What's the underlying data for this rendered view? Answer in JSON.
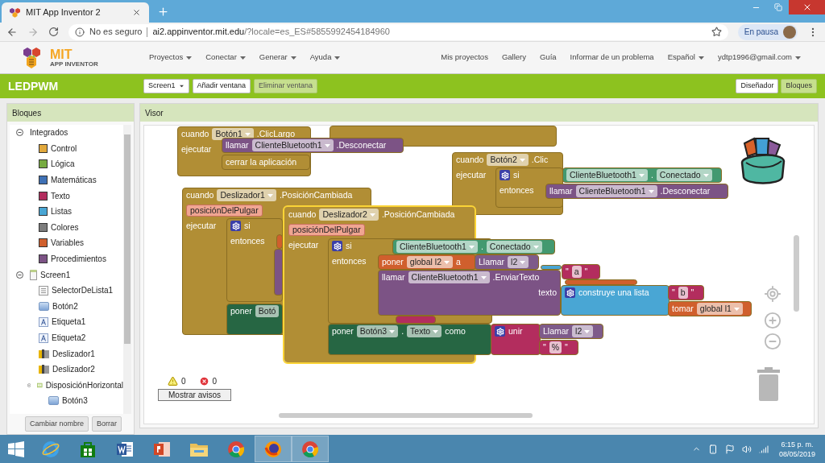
{
  "browser": {
    "tab_title": "MIT App Inventor 2",
    "security": "No es seguro",
    "url_host": "ai2.appinventor.mit.edu",
    "url_rest": "/?locale=es_ES#5855992454184960",
    "profile_status": "En pausa"
  },
  "app": {
    "logo": {
      "mark": "MIT",
      "name": "APP INVENTOR"
    },
    "menus": [
      {
        "label": "Proyectos",
        "dropdown": true
      },
      {
        "label": "Conectar",
        "dropdown": true
      },
      {
        "label": "Generar",
        "dropdown": true
      },
      {
        "label": "Ayuda",
        "dropdown": true
      }
    ],
    "right_links": [
      {
        "label": "Mis proyectos",
        "dropdown": false
      },
      {
        "label": "Gallery",
        "dropdown": false
      },
      {
        "label": "Guía",
        "dropdown": false
      },
      {
        "label": "Informar de un problema",
        "dropdown": false
      },
      {
        "label": "Español",
        "dropdown": true
      },
      {
        "label": "ydtp1996@gmail.com",
        "dropdown": true
      }
    ]
  },
  "project_bar": {
    "name": "LEDPWM",
    "screen": "Screen1",
    "buttons": [
      {
        "label": "Añadir ventana",
        "disabled": false
      },
      {
        "label": "Eliminar ventana",
        "disabled": true
      }
    ],
    "modes": [
      {
        "label": "Diseñador",
        "selected": false
      },
      {
        "label": "Bloques",
        "selected": true
      }
    ]
  },
  "blocks_panel": {
    "title": "Bloques",
    "tree": [
      {
        "label": "Integrados",
        "expanded": true,
        "children": [
          {
            "label": "Control",
            "color": "#e1a83c"
          },
          {
            "label": "Lógica",
            "color": "#77ab41"
          },
          {
            "label": "Matemáticas",
            "color": "#3f71b5"
          },
          {
            "label": "Texto",
            "color": "#b32d5e"
          },
          {
            "label": "Listas",
            "color": "#49a6d4"
          },
          {
            "label": "Colores",
            "color": "#7d7d7d"
          },
          {
            "label": "Variables",
            "color": "#d05f2d"
          },
          {
            "label": "Procedimientos",
            "color": "#7c5385"
          }
        ]
      },
      {
        "label": "Screen1",
        "kind": "screen",
        "expanded": true,
        "children": [
          {
            "label": "SelectorDeLista1",
            "kind": "listpicker"
          },
          {
            "label": "Botón2",
            "kind": "button"
          },
          {
            "label": "Etiqueta1",
            "kind": "label"
          },
          {
            "label": "Etiqueta2",
            "kind": "label"
          },
          {
            "label": "Deslizador1",
            "kind": "slider"
          },
          {
            "label": "Deslizador2",
            "kind": "slider"
          },
          {
            "label": "DisposiciónHorizontal",
            "kind": "arrangement",
            "expanded": true,
            "children": [
              {
                "label": "Botón3",
                "kind": "button"
              }
            ]
          }
        ]
      }
    ],
    "buttons": [
      "Cambiar nombre",
      "Borrar"
    ]
  },
  "viewer": {
    "title": "Visor",
    "blocks": [
      {
        "kind": "control",
        "selected": false
      },
      {
        "kind": "control",
        "selected": false,
        "rows": [
          [
            {
              "kind": "text",
              "text": "cuando"
            },
            {
              "kind": "field",
              "text": "Botón1"
            },
            {
              "kind": "text",
              "text": ".ClicLargo"
            }
          ],
          [
            {
              "kind": "text",
              "text": "ejecutar"
            }
          ]
        ],
        "children": [
          {
            "kind": "method",
            "selected": false,
            "rows": [
              [
                {
                  "kind": "text",
                  "text": "llamar"
                },
                {
                  "kind": "field",
                  "text": "ClienteBluetooth1"
                },
                {
                  "kind": "text",
                  "text": ".Desconectar"
                }
              ]
            ]
          },
          {
            "kind": "control",
            "selected": false,
            "rows": [
              [
                {
                  "kind": "text",
                  "text": "cerrar la aplicación"
                }
              ]
            ]
          }
        ]
      },
      {
        "kind": "control",
        "selected": false,
        "rows": [
          [
            {
              "kind": "text",
              "text": "cuando"
            },
            {
              "kind": "field",
              "text": "Botón2"
            },
            {
              "kind": "text",
              "text": ".Clic"
            }
          ],
          [
            {
              "kind": "text",
              "text": "ejecutar"
            }
          ]
        ],
        "children": [
          {
            "kind": "control",
            "selected": false,
            "rows": [
              [
                {
                  "kind": "gear"
                },
                {
                  "kind": "text",
                  "text": "si"
                }
              ],
              [
                {
                  "kind": "text",
                  "text": "entonces"
                }
              ]
            ],
            "children": [
              {
                "kind": "getter",
                "selected": false,
                "rows": [
                  [
                    {
                      "kind": "field",
                      "text": "ClienteBluetooth1"
                    },
                    {
                      "kind": "text",
                      "text": "."
                    },
                    {
                      "kind": "field",
                      "text": "Conectado"
                    }
                  ]
                ]
              },
              {
                "kind": "method",
                "selected": false,
                "rows": [
                  [
                    {
                      "kind": "text",
                      "text": "llamar"
                    },
                    {
                      "kind": "field",
                      "text": "ClienteBluetooth1"
                    },
                    {
                      "kind": "text",
                      "text": ".Desconectar"
                    }
                  ]
                ]
              }
            ]
          }
        ]
      },
      {
        "kind": "control",
        "selected": false,
        "rows": [
          [
            {
              "kind": "text",
              "text": "cuando"
            },
            {
              "kind": "field",
              "text": "Deslizador1"
            },
            {
              "kind": "text",
              "text": ".PosiciónCambiada"
            }
          ],
          [
            {
              "kind": "param",
              "text": "posiciónDelPulgar"
            }
          ],
          [
            {
              "kind": "text",
              "text": "ejecutar"
            }
          ]
        ],
        "children": [
          {
            "kind": "control",
            "selected": false,
            "rows": [
              [
                {
                  "kind": "gear"
                },
                {
                  "kind": "text",
                  "text": "si"
                }
              ],
              [
                {
                  "kind": "text",
                  "text": "entonces"
                }
              ]
            ],
            "children": [
              {
                "kind": "variable",
                "selected": false
              },
              {
                "kind": "method",
                "selected": false
              }
            ]
          },
          {
            "kind": "setter",
            "selected": false,
            "rows": [
              [
                {
                  "kind": "text",
                  "text": "poner"
                },
                {
                  "kind": "label",
                  "text": "Botó"
                }
              ]
            ]
          }
        ]
      },
      {
        "kind": "control",
        "selected": true,
        "rows": [
          [
            {
              "kind": "text",
              "text": "cuando"
            },
            {
              "kind": "field",
              "text": "Deslizador2"
            },
            {
              "kind": "text",
              "text": ".PosiciónCambiada"
            }
          ],
          [
            {
              "kind": "param",
              "text": "posiciónDelPulgar"
            }
          ],
          [
            {
              "kind": "text",
              "text": "ejecutar"
            }
          ]
        ],
        "children": [
          {
            "kind": "control",
            "selected": false,
            "rows": [
              [
                {
                  "kind": "gear"
                },
                {
                  "kind": "text",
                  "text": "si"
                }
              ],
              [
                {
                  "kind": "text",
                  "text": "entonces"
                }
              ]
            ],
            "children": [
              {
                "kind": "getter",
                "selected": false,
                "rows": [
                  [
                    {
                      "kind": "field",
                      "text": "ClienteBluetooth1"
                    },
                    {
                      "kind": "text",
                      "text": "."
                    },
                    {
                      "kind": "field",
                      "text": "Conectado"
                    }
                  ]
                ]
              },
              {
                "kind": "variable",
                "selected": false,
                "rows": [
                  [
                    {
                      "kind": "text",
                      "text": "poner"
                    },
                    {
                      "kind": "field",
                      "text": "global l2"
                    },
                    {
                      "kind": "text",
                      "text": "a"
                    }
                  ]
                ],
                "children": [
                  {
                    "kind": "procedure",
                    "selected": false,
                    "rows": [
                      [
                        {
                          "kind": "text",
                          "text": "Llamar"
                        },
                        {
                          "kind": "field",
                          "text": "l2"
                        }
                      ]
                    ]
                  }
                ]
              },
              {
                "kind": "list",
                "selected": false
              },
              {
                "kind": "text",
                "selected": false,
                "rows": [
                  [
                    {
                      "kind": "text",
                      "text": "\""
                    },
                    {
                      "kind": "literal",
                      "text": "a"
                    },
                    {
                      "kind": "text",
                      "text": "\""
                    }
                  ]
                ]
              },
              {
                "kind": "variable",
                "selected": false
              },
              {
                "kind": "method",
                "selected": false,
                "rows": [
                  [
                    {
                      "kind": "text",
                      "text": "llamar"
                    },
                    {
                      "kind": "field",
                      "text": "ClienteBluetooth1"
                    },
                    {
                      "kind": "text",
                      "text": ".EnviarTexto"
                    }
                  ],
                  [
                    {
                      "kind": "text",
                      "text": "texto"
                    }
                  ]
                ],
                "children": [
                  {
                    "kind": "list",
                    "selected": false,
                    "rows": [
                      [
                        {
                          "kind": "gear"
                        },
                        {
                          "kind": "text",
                          "text": "construye una lista"
                        }
                      ]
                    ],
                    "children": [
                      {
                        "kind": "text",
                        "selected": false,
                        "rows": [
                          [
                            {
                              "kind": "text",
                              "text": "\""
                            },
                            {
                              "kind": "literal",
                              "text": "b"
                            },
                            {
                              "kind": "text",
                              "text": "\""
                            }
                          ]
                        ]
                      },
                      {
                        "kind": "variable",
                        "selected": false,
                        "rows": [
                          [
                            {
                              "kind": "text",
                              "text": "tomar"
                            },
                            {
                              "kind": "field",
                              "text": "global l1"
                            }
                          ]
                        ]
                      }
                    ]
                  }
                ]
              },
              {
                "kind": "text",
                "selected": false
              }
            ]
          },
          {
            "kind": "setter",
            "selected": false,
            "rows": [
              [
                {
                  "kind": "text",
                  "text": "poner"
                },
                {
                  "kind": "field",
                  "text": "Botón3"
                },
                {
                  "kind": "text",
                  "text": "."
                },
                {
                  "kind": "field",
                  "text": "Texto"
                },
                {
                  "kind": "text",
                  "text": "como"
                }
              ]
            ],
            "children": [
              {
                "kind": "text",
                "selected": false,
                "rows": [
                  [
                    {
                      "kind": "gear"
                    },
                    {
                      "kind": "text",
                      "text": "unir"
                    }
                  ]
                ],
                "children": [
                  {
                    "kind": "procedure",
                    "selected": false,
                    "rows": [
                      [
                        {
                          "kind": "text",
                          "text": "Llamar"
                        },
                        {
                          "kind": "field",
                          "text": "l2"
                        }
                      ]
                    ]
                  },
                  {
                    "kind": "text",
                    "selected": false,
                    "rows": [
                      [
                        {
                          "kind": "text",
                          "text": "\""
                        },
                        {
                          "kind": "literal",
                          "text": "%"
                        },
                        {
                          "kind": "text",
                          "text": "\""
                        }
                      ]
                    ]
                  }
                ]
              }
            ]
          }
        ]
      }
    ],
    "warnings": {
      "warning_count": "0",
      "error_count": "0",
      "button": "Mostrar avisos"
    }
  },
  "taskbar": {
    "apps": [
      {
        "kind": "ie",
        "active": false
      },
      {
        "kind": "store",
        "active": false
      },
      {
        "kind": "word",
        "active": false
      },
      {
        "kind": "powerpoint",
        "active": false
      },
      {
        "kind": "explorer",
        "active": false
      },
      {
        "kind": "chrome",
        "active": false
      },
      {
        "kind": "firefox",
        "active": true
      },
      {
        "kind": "chrome",
        "active": true
      }
    ],
    "time": "6:15 p. m.",
    "date": "08/05/2019"
  }
}
